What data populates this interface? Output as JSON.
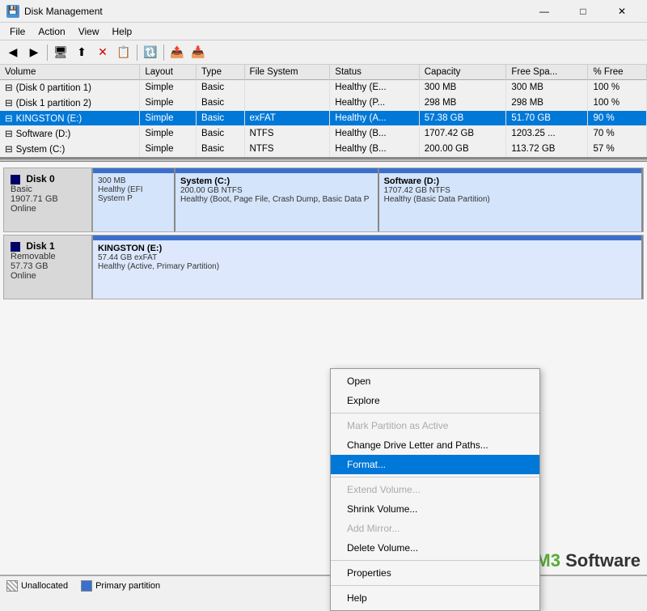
{
  "window": {
    "title": "Disk Management",
    "icon": "💾"
  },
  "title_controls": {
    "minimize": "—",
    "maximize": "□",
    "close": "✕"
  },
  "menu": {
    "items": [
      "File",
      "Action",
      "View",
      "Help"
    ]
  },
  "toolbar": {
    "buttons": [
      "◀",
      "▶",
      "📄",
      "⬆",
      "❌",
      "📋",
      "🔃",
      "📤",
      "📥"
    ]
  },
  "table": {
    "columns": [
      "Volume",
      "Layout",
      "Type",
      "File System",
      "Status",
      "Capacity",
      "Free Spa...",
      "% Free"
    ],
    "rows": [
      {
        "volume": "(Disk 0 partition 1)",
        "layout": "Simple",
        "type": "Basic",
        "filesystem": "",
        "status": "Healthy (E...",
        "capacity": "300 MB",
        "freespace": "300 MB",
        "pctfree": "100 %"
      },
      {
        "volume": "(Disk 1 partition 2)",
        "layout": "Simple",
        "type": "Basic",
        "filesystem": "",
        "status": "Healthy (P...",
        "capacity": "298 MB",
        "freespace": "298 MB",
        "pctfree": "100 %"
      },
      {
        "volume": "KINGSTON (E:)",
        "layout": "Simple",
        "type": "Basic",
        "filesystem": "exFAT",
        "status": "Healthy (A...",
        "capacity": "57.38 GB",
        "freespace": "51.70 GB",
        "pctfree": "90 %"
      },
      {
        "volume": "Software (D:)",
        "layout": "Simple",
        "type": "Basic",
        "filesystem": "NTFS",
        "status": "Healthy (B...",
        "capacity": "1707.42 GB",
        "freespace": "1203.25 ...",
        "pctfree": "70 %"
      },
      {
        "volume": "System (C:)",
        "layout": "Simple",
        "type": "Basic",
        "filesystem": "NTFS",
        "status": "Healthy (B...",
        "capacity": "200.00 GB",
        "freespace": "113.72 GB",
        "pctfree": "57 %"
      }
    ]
  },
  "disks": [
    {
      "name": "Disk 0",
      "type": "Basic",
      "size": "1907.71 GB",
      "status": "Online",
      "partitions": [
        {
          "label": "",
          "size_label": "300 MB",
          "fs": "",
          "desc": "Healthy (EFI System P",
          "width_pct": 15,
          "bar_class": "part-blue",
          "bg": "#d4e4fa"
        },
        {
          "label": "System (C:)",
          "size_label": "200.00 GB NTFS",
          "fs": "NTFS",
          "desc": "Healthy (Boot, Page File, Crash Dump, Basic Data P",
          "width_pct": 37,
          "bar_class": "part-blue",
          "bg": "#d4e4fa"
        },
        {
          "label": "Software (D:)",
          "size_label": "1707.42 GB NTFS",
          "fs": "NTFS",
          "desc": "Healthy (Basic Data Partition)",
          "width_pct": 48,
          "bar_class": "part-blue",
          "bg": "#d4e4fa"
        }
      ]
    },
    {
      "name": "Disk 1",
      "type": "Removable",
      "size": "57.73 GB",
      "status": "Online",
      "partitions": [
        {
          "label": "KINGSTON (E:)",
          "size_label": "57.44 GB exFAT",
          "fs": "exFAT",
          "desc": "Healthy (Active, Primary Partition)",
          "width_pct": 100,
          "bar_class": "part-blue",
          "bg": "#dde8fc"
        }
      ]
    }
  ],
  "context_menu": {
    "items": [
      {
        "label": "Open",
        "type": "normal"
      },
      {
        "label": "Explore",
        "type": "normal"
      },
      {
        "type": "separator"
      },
      {
        "label": "Mark Partition as Active",
        "type": "disabled"
      },
      {
        "label": "Change Drive Letter and Paths...",
        "type": "normal"
      },
      {
        "label": "Format...",
        "type": "highlighted"
      },
      {
        "type": "separator"
      },
      {
        "label": "Extend Volume...",
        "type": "disabled"
      },
      {
        "label": "Shrink Volume...",
        "type": "normal"
      },
      {
        "label": "Add Mirror...",
        "type": "disabled"
      },
      {
        "label": "Delete Volume...",
        "type": "normal"
      },
      {
        "type": "separator"
      },
      {
        "label": "Properties",
        "type": "normal"
      },
      {
        "type": "separator"
      },
      {
        "label": "Help",
        "type": "normal"
      }
    ]
  },
  "legend": {
    "unallocated": "Unallocated",
    "primary": "Primary partition"
  },
  "watermark": {
    "prefix": "M3 ",
    "suffix": "Software"
  }
}
